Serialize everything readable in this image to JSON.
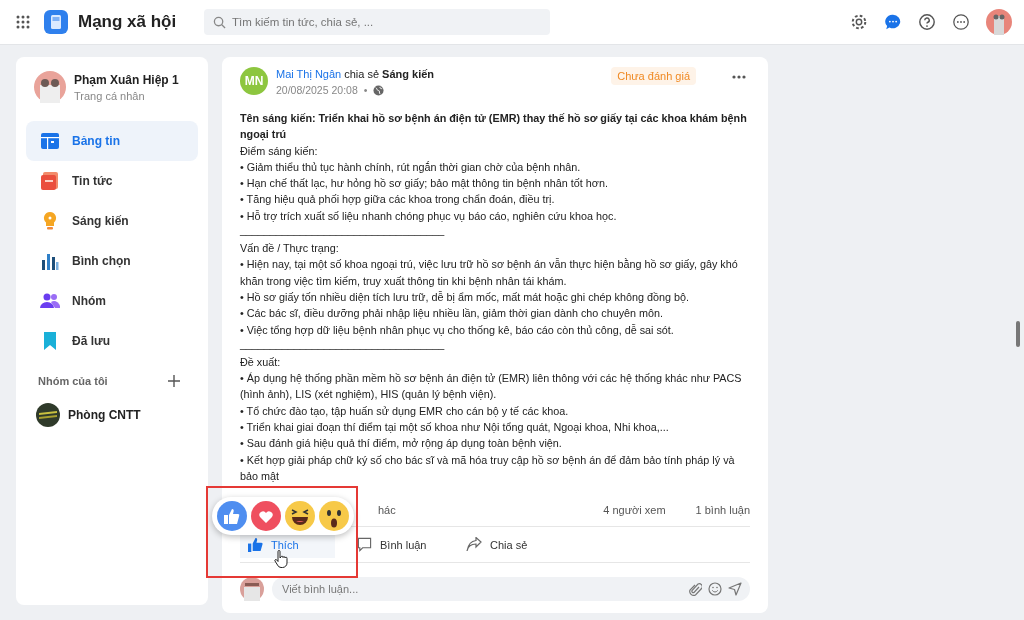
{
  "header": {
    "app_title": "Mạng xã hội",
    "search": {
      "placeholder": "Tìm kiếm tin tức, chia sẻ, ..."
    }
  },
  "sidebar": {
    "profile": {
      "name": "Phạm Xuân Hiệp 1",
      "subtitle": "Trang cá nhân"
    },
    "items": [
      {
        "label": "Bảng tin",
        "kind": "feed",
        "selected": true
      },
      {
        "label": "Tin tức",
        "kind": "news",
        "selected": false
      },
      {
        "label": "Sáng kiến",
        "kind": "idea",
        "selected": false
      },
      {
        "label": "Bình chọn",
        "kind": "poll",
        "selected": false
      },
      {
        "label": "Nhóm",
        "kind": "group",
        "selected": false
      },
      {
        "label": "Đã lưu",
        "kind": "saved",
        "selected": false
      }
    ],
    "groups_heading": "Nhóm của tôi",
    "groups": [
      {
        "name": "Phòng CNTT"
      }
    ]
  },
  "post": {
    "author_initials": "MN",
    "author": "Mai Thị Ngân",
    "verb": "chia sẻ",
    "category": "Sáng kiến",
    "time": "20/08/2025 20:08",
    "separator_dot": "•",
    "status": "Chưa đánh giá",
    "lines": [
      {
        "kind": "title",
        "text": "Tên sáng kiến: Triển khai hồ sơ bệnh án điện tử (EMR) thay thế hồ sơ giấy tại các khoa khám bệnh ngoại trú"
      },
      {
        "kind": "text",
        "text": "Điểm sáng kiến:"
      },
      {
        "kind": "text",
        "text": "• Giảm thiểu thủ tục hành chính, rút ngắn thời gian chờ của bệnh nhân."
      },
      {
        "kind": "text",
        "text": "• Hạn chế thất lạc, hư hỏng hồ sơ giấy; bảo mật thông tin bệnh nhân tốt hơn."
      },
      {
        "kind": "text",
        "text": "• Tăng hiệu quả phối hợp giữa các khoa trong chẩn đoán, điều trị."
      },
      {
        "kind": "text",
        "text": "• Hỗ trợ trích xuất số liệu nhanh chóng phục vụ báo cáo, nghiên cứu khoa học."
      },
      {
        "kind": "separator",
        "text": "__________________________________"
      },
      {
        "kind": "text",
        "text": "Vấn đề / Thực trạng:"
      },
      {
        "kind": "text",
        "text": "• Hiện nay, tại một số khoa ngoại trú, việc lưu trữ hồ sơ bệnh án vẫn thực hiện bằng hồ sơ giấy, gây khó khăn trong việc tìm kiếm, truy xuất thông tin khi bệnh nhân tái khám."
      },
      {
        "kind": "text",
        "text": "• Hồ sơ giấy tốn nhiều diện tích lưu trữ, dễ bị ẩm mốc, mất mát hoặc ghi chép không đồng bộ."
      },
      {
        "kind": "text",
        "text": "• Các bác sĩ, điều dưỡng phải nhập liệu nhiều lần, giảm thời gian dành cho chuyên môn."
      },
      {
        "kind": "text",
        "text": "• Việc tổng hợp dữ liệu bệnh nhân phục vụ cho thống kê, báo cáo còn thủ công, dễ sai sót."
      },
      {
        "kind": "separator",
        "text": "__________________________________"
      },
      {
        "kind": "text",
        "text": "Đề xuất:"
      },
      {
        "kind": "text",
        "text": "• Áp dụng hệ thống phần mềm hồ sơ bệnh án điện tử (EMR) liên thông với các hệ thống khác như PACS (hình ảnh), LIS (xét nghiệm), HIS (quản lý bệnh viện)."
      },
      {
        "kind": "text",
        "text": "• Tổ chức đào tạo, tập huấn sử dụng EMR cho cán bộ y tế các khoa."
      },
      {
        "kind": "text",
        "text": "• Triển khai giai đoạn thí điểm tại một số khoa như Nội tổng quát, Ngoại khoa, Nhi khoa,..."
      },
      {
        "kind": "text",
        "text": "• Sau đánh giá hiệu quả thí điểm, mở rộng áp dụng toàn bệnh viện."
      },
      {
        "kind": "text",
        "text": "• Kết hợp giải pháp chữ ký số cho bác sĩ và mã hóa truy cập hồ sơ bệnh án để đảm bảo tính pháp lý và bảo mật"
      }
    ],
    "reactions_text": "hác",
    "views": "4 người xem",
    "comments": "1 bình luận",
    "actions": [
      {
        "kind": "like",
        "label": "Thích",
        "selected": true
      },
      {
        "kind": "comment",
        "label": "Bình luận",
        "selected": false
      },
      {
        "kind": "share",
        "label": "Chia sẻ",
        "selected": false
      }
    ],
    "comment_field": {
      "placeholder": "Viết bình luận..."
    }
  }
}
